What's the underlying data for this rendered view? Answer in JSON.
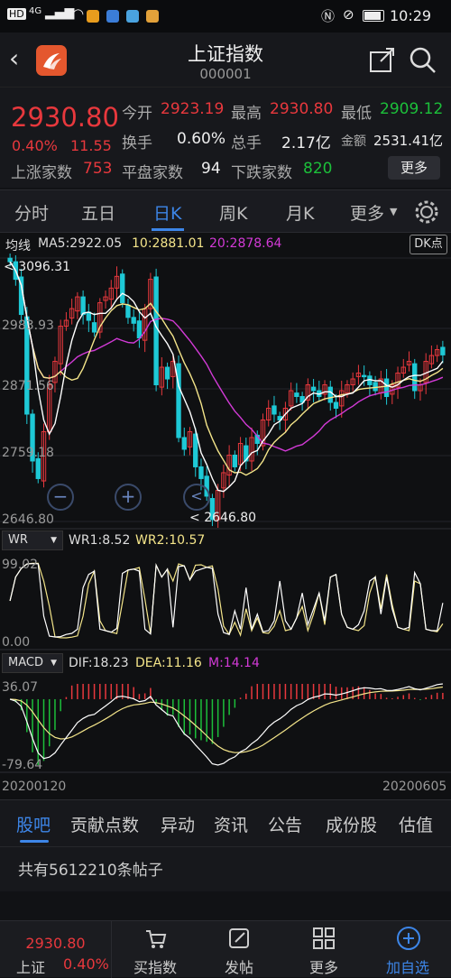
{
  "statusbar": {
    "network": "4G",
    "time": "10:29"
  },
  "header": {
    "title": "上证指数",
    "code": "000001"
  },
  "quote": {
    "price": "2930.80",
    "change_pct": "0.40%",
    "change": "11.55",
    "open_label": "今开",
    "open": "2923.19",
    "high_label": "最高",
    "high": "2930.80",
    "low_label": "最低",
    "low": "2909.12",
    "turnover_label": "换手",
    "turnover": "0.60%",
    "volume_label": "总手",
    "volume": "2.17亿",
    "amount_label": "金额",
    "amount": "2531.41亿",
    "up_label": "上涨家数",
    "up": "753",
    "flat_label": "平盘家数",
    "flat": "94",
    "down_label": "下跌家数",
    "down": "820",
    "more": "更多"
  },
  "tabs": [
    "分时",
    "五日",
    "日K",
    "周K",
    "月K",
    "更多"
  ],
  "active_tab": "日K",
  "chart_info": {
    "ma_label": "均线",
    "ma5": "MA5:2922.05",
    "ma10": "10:2881.01",
    "ma20": "20:2878.64",
    "dk_button": "DK点",
    "price_high_mark": "3096.31",
    "price_low_mark": "2646.80",
    "y_ticks": [
      "2983.93",
      "2871.56",
      "2759.18",
      "2646.80"
    ],
    "wr_tag": "WR",
    "wr1": "WR1:8.52",
    "wr2": "WR2:10.57",
    "wr_ticks": [
      "99.02",
      "0.00"
    ],
    "macd_tag": "MACD",
    "dif": "DIF:18.23",
    "dea": "DEA:11.16",
    "m": "M:14.14",
    "macd_ticks": [
      "36.07",
      "-79.64"
    ],
    "date_start": "20200120",
    "date_end": "20200605"
  },
  "chart_data": {
    "type": "candlestick",
    "x_range": [
      "20200120",
      "20200605"
    ],
    "y_range": [
      2646.8,
      3096.31
    ],
    "close": [
      3090,
      3060,
      3000,
      2830,
      2750,
      2720,
      2800,
      2880,
      2920,
      2980,
      2990,
      3010,
      3030,
      3000,
      2990,
      2970,
      3020,
      3030,
      3045,
      3065,
      3020,
      2995,
      2985,
      2960,
      3010,
      3060,
      2880,
      2910,
      2890,
      2920,
      2790,
      2770,
      2800,
      2740,
      2720,
      2690,
      2650,
      2700,
      2730,
      2760,
      2740,
      2780,
      2750,
      2790,
      2780,
      2820,
      2840,
      2830,
      2820,
      2840,
      2870,
      2860,
      2850,
      2880,
      2870,
      2860,
      2880,
      2850,
      2840,
      2870,
      2880,
      2890,
      2900,
      2895,
      2880,
      2870,
      2890,
      2860,
      2880,
      2900,
      2910,
      2920,
      2870,
      2880,
      2920,
      2930,
      2940,
      2931
    ],
    "colors": {
      "up": "#e8383d",
      "down": "#1ec9d6",
      "ma5": "#ffffff",
      "ma10": "#f4e58a",
      "ma20": "#d23ad6"
    }
  },
  "bottom_tabs": [
    "股吧",
    "贡献点数",
    "异动",
    "资讯",
    "公告",
    "成份股",
    "估值"
  ],
  "active_bottom": "股吧",
  "posts": "共有5612210条帖子",
  "navbar": {
    "index_price": "2930.80",
    "index_name": "上证",
    "index_pct": "0.40%",
    "items": [
      "买指数",
      "发帖",
      "更多",
      "加自选"
    ]
  }
}
